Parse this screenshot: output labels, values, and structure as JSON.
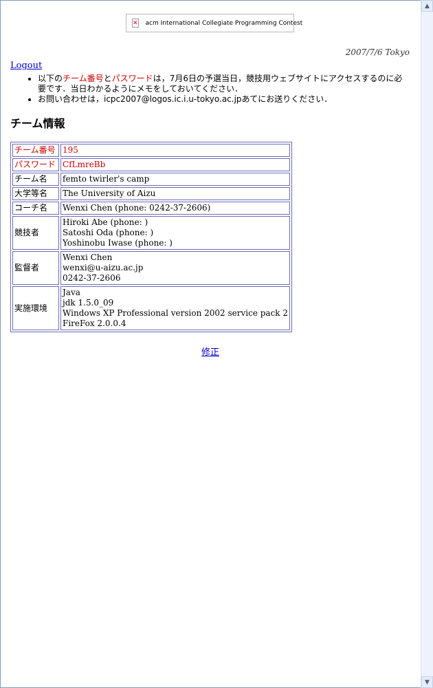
{
  "banner": {
    "text": "acm International Collegiate Programming Contest"
  },
  "date": "2007/7/6 Tokyo",
  "logout_label": "Logout",
  "notes": {
    "line1_pre": "以下の",
    "line1_team_no": "チーム番号",
    "line1_and": "と",
    "line1_password": "パスワード",
    "line1_post": "は，7月6日の予選当日，競技用ウェブサイトにアクセスするのに必要です．当日わかるようにメモをしておいてください．",
    "line2": "お問い合わせは，icpc2007@logos.ic.i.u-tokyo.ac.jpあてにお送りください．"
  },
  "heading": "チーム情報",
  "team": {
    "team_no_label": "チーム番号",
    "team_no": "195",
    "password_label": "パスワード",
    "password": "CfLmreBb",
    "team_name_label": "チーム名",
    "team_name": "femto twirler's camp",
    "university_label": "大学等名",
    "university": "The University of Aizu",
    "coach_label": "コーチ名",
    "coach": "Wenxi Chen (phone: 0242-37-2606)",
    "contestants_label": "競技者",
    "contestants": [
      "Hiroki Abe (phone: )",
      "Satoshi Oda (phone: )",
      "Yoshinobu Iwase (phone: )"
    ],
    "supervisor_label": "監督者",
    "supervisor": [
      "Wenxi Chen",
      "wenxi@u-aizu.ac.jp",
      "0242-37-2606"
    ],
    "environment_label": "実施環境",
    "environment": [
      "Java",
      "jdk 1.5.0_09",
      "Windows XP Professional version 2002 service pack 2",
      "FireFox 2.0.0.4"
    ]
  },
  "edit_label": "修正",
  "colors": {
    "link": "#0000cc",
    "highlight": "#cc0000",
    "table_border": "#6a6ab5"
  }
}
